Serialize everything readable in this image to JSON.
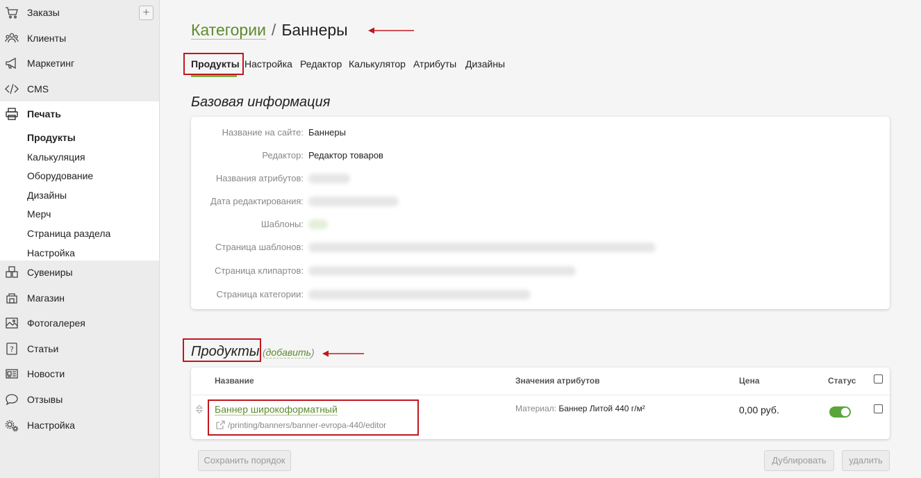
{
  "sidebar": {
    "items": [
      {
        "label": "Заказы",
        "icon": "cart-icon"
      },
      {
        "label": "Клиенты",
        "icon": "users-icon"
      },
      {
        "label": "Маркетинг",
        "icon": "megaphone-icon"
      },
      {
        "label": "CMS",
        "icon": "code-icon"
      },
      {
        "label": "Печать",
        "icon": "printer-icon"
      },
      {
        "label": "Сувениры",
        "icon": "gift-boxes-icon"
      },
      {
        "label": "Магазин",
        "icon": "shop-icon"
      },
      {
        "label": "Фотогалерея",
        "icon": "image-icon"
      },
      {
        "label": "Статьи",
        "icon": "question-icon"
      },
      {
        "label": "Новости",
        "icon": "newspaper-icon"
      },
      {
        "label": "Отзывы",
        "icon": "chat-icon"
      },
      {
        "label": "Настройка",
        "icon": "gears-icon"
      }
    ],
    "print_subitems": [
      "Продукты",
      "Калькуляция",
      "Оборудование",
      "Дизайны",
      "Мерч",
      "Страница раздела",
      "Настройка"
    ],
    "add_button_label": "+"
  },
  "breadcrumb": {
    "parent": "Категории",
    "separator": "/",
    "current": "Баннеры"
  },
  "tabs": [
    "Продукты",
    "Настройка",
    "Редактор",
    "Калькулятор",
    "Атрибуты",
    "Дизайны"
  ],
  "base_info": {
    "title": "Базовая информация",
    "rows": [
      {
        "label": "Название на сайте:",
        "value": "Баннеры"
      },
      {
        "label": "Редактор:",
        "value": "Редактор товаров"
      },
      {
        "label": "Названия атрибутов:",
        "value": ""
      },
      {
        "label": "Дата редактирования:",
        "value": ""
      },
      {
        "label": "Шаблоны:",
        "value": ""
      },
      {
        "label": "Страница шаблонов:",
        "value": ""
      },
      {
        "label": "Страница клипартов:",
        "value": ""
      },
      {
        "label": "Страница категории:",
        "value": ""
      }
    ]
  },
  "products": {
    "title": "Продукты",
    "add_prefix": "(",
    "add_link": "добавить",
    "add_suffix": ")",
    "columns": {
      "name": "Название",
      "attributes": "Значения атрибутов",
      "price": "Цена",
      "status": "Статус"
    },
    "rows": [
      {
        "name": "Баннер широкоформатный",
        "url": "/printing/banners/banner-evropa-440/editor",
        "attr_label": "Материал:",
        "attr_value": "Баннер Литой 440 г/м²",
        "price": "0,00 руб.",
        "status_on": true
      }
    ]
  },
  "buttons": {
    "save_order": "Сохранить порядок",
    "duplicate": "Дублировать",
    "delete": "удалить"
  },
  "colors": {
    "accent_green": "#5e8a2e",
    "toggle_green": "#5aa63a",
    "annotation_red": "#c0161e"
  }
}
